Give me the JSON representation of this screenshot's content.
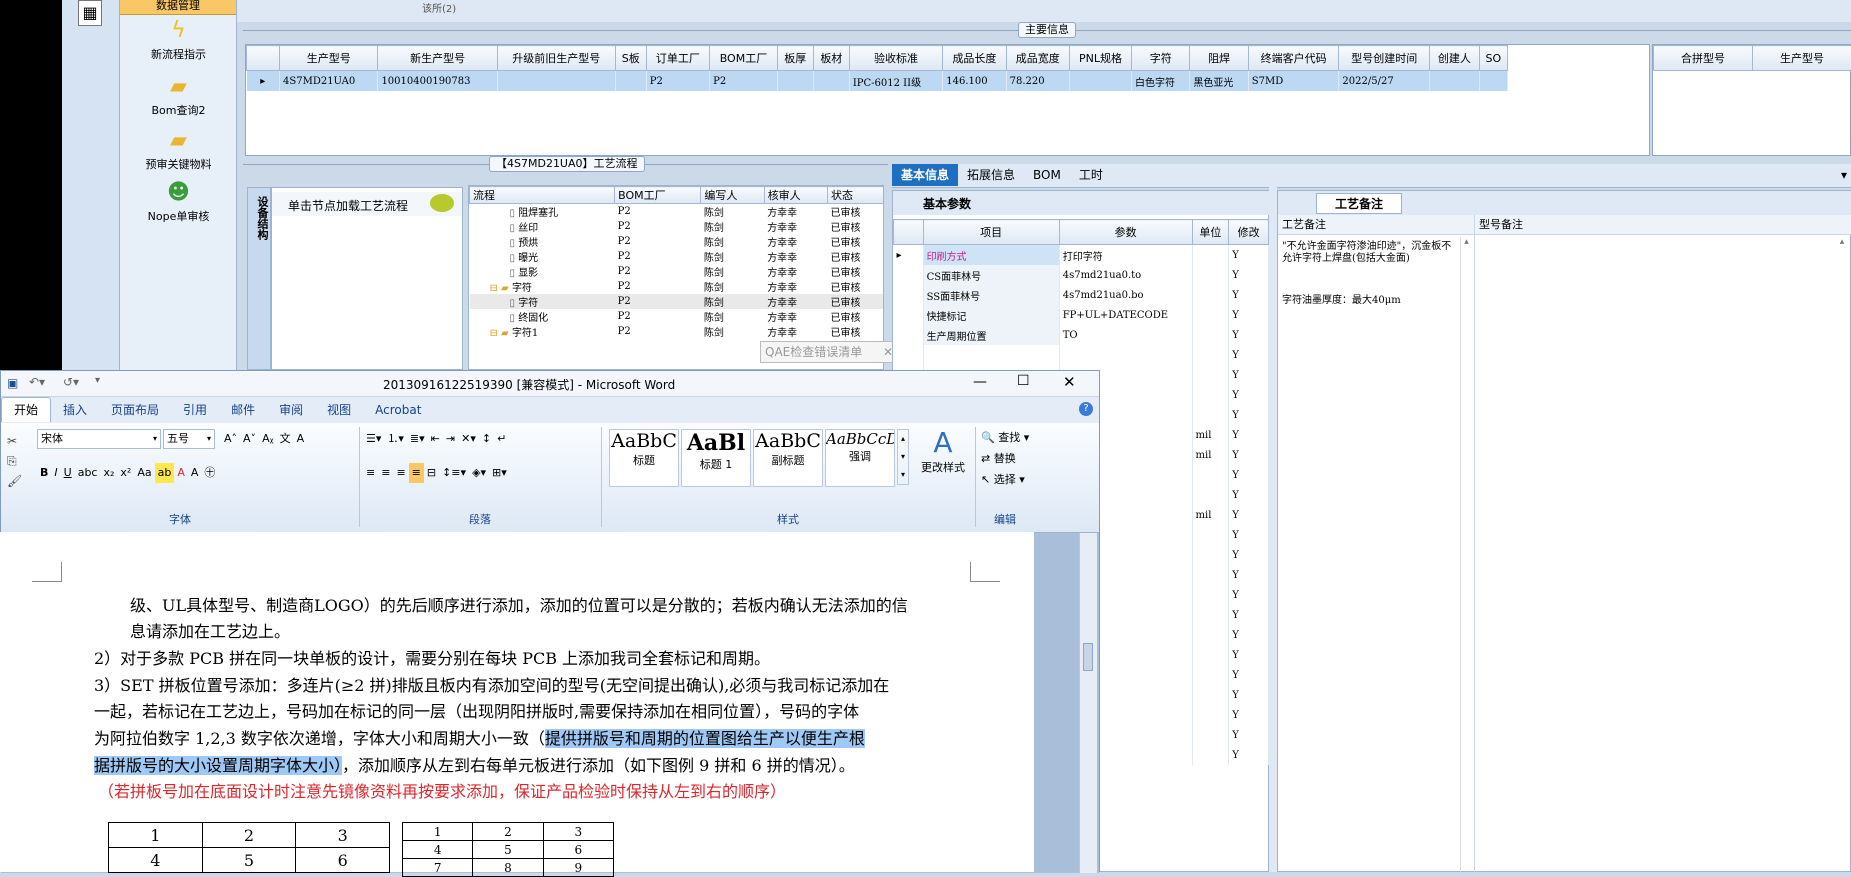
{
  "left_nav": {
    "top_tab": "数据管理"
  },
  "quick_items": [
    {
      "label": "新流程指示",
      "icon": "lightning-icon"
    },
    {
      "label": "Bom查询2",
      "icon": "folder-icon"
    },
    {
      "label": "预审关键物料",
      "icon": "folder-icon"
    },
    {
      "label": "Nope单审核",
      "icon": "user-icon"
    }
  ],
  "top_text": "该所(2)",
  "main_info": {
    "title": "主要信息",
    "columns": [
      "生产型号",
      "新生产型号",
      "升级前旧生产型号",
      "S板",
      "订单工厂",
      "BOM工厂",
      "板厚",
      "板材",
      "验收标准",
      "成品长度",
      "成品宽度",
      "PNL规格",
      "字符",
      "阻焊",
      "终端客户代码",
      "型号创建时间",
      "创建人",
      "SO"
    ],
    "row": [
      "4S7MD21UA0",
      "10010400190783",
      "",
      "",
      "P2",
      "P2",
      "",
      "",
      "IPC-6012 II级",
      "146.100",
      "78.220",
      "",
      "白色字符",
      "黑色亚光",
      "S7MD",
      "2022/5/27",
      "",
      ""
    ],
    "right_columns": [
      "合拼型号",
      "生产型号"
    ]
  },
  "process": {
    "title": "【4S7MD21UA0】工艺流程",
    "side_tab": "设备结构",
    "hint": "单击节点加载工艺流程",
    "columns": [
      "流程",
      "BOM工厂",
      "编写人",
      "核审人",
      "状态"
    ],
    "rows": [
      {
        "name": "阻焊塞孔",
        "bom": "P2",
        "writer": "陈剑",
        "reviewer": "方幸幸",
        "status": "已审核"
      },
      {
        "name": "丝印",
        "bom": "P2",
        "writer": "陈剑",
        "reviewer": "方幸幸",
        "status": "已审核"
      },
      {
        "name": "预烘",
        "bom": "P2",
        "writer": "陈剑",
        "reviewer": "方幸幸",
        "status": "已审核"
      },
      {
        "name": "曝光",
        "bom": "P2",
        "writer": "陈剑",
        "reviewer": "方幸幸",
        "status": "已审核"
      },
      {
        "name": "显影",
        "bom": "P2",
        "writer": "陈剑",
        "reviewer": "方幸幸",
        "status": "已审核"
      },
      {
        "name": "字符",
        "bom": "P2",
        "writer": "陈剑",
        "reviewer": "方幸幸",
        "status": "已审核"
      },
      {
        "name": "字符",
        "bom": "P2",
        "writer": "陈剑",
        "reviewer": "方幸幸",
        "status": "已审核"
      },
      {
        "name": "终固化",
        "bom": "P2",
        "writer": "陈剑",
        "reviewer": "方幸幸",
        "status": "已审核"
      },
      {
        "name": "字符1",
        "bom": "P2",
        "writer": "陈剑",
        "reviewer": "方幸幸",
        "status": "已审核"
      }
    ],
    "qae_popup": "QAE检查错误清单"
  },
  "right_tabs": [
    "基本信息",
    "拓展信息",
    "BOM",
    "工时"
  ],
  "basic_params": {
    "title": "基本参数",
    "columns": [
      "项目",
      "参数",
      "单位",
      "修改"
    ],
    "rows": [
      {
        "item": "印刷方式",
        "param": "打印字符",
        "unit": "",
        "mod": "Y"
      },
      {
        "item": "CS面菲林号",
        "param": "4s7md21ua0.to",
        "unit": "",
        "mod": "Y"
      },
      {
        "item": "SS面菲林号",
        "param": "4s7md21ua0.bo",
        "unit": "",
        "mod": "Y"
      },
      {
        "item": "快捷标记",
        "param": "FP+UL+DATECODE",
        "unit": "",
        "mod": "Y"
      },
      {
        "item": "生产周期位置",
        "param": "TO",
        "unit": "",
        "mod": "Y"
      }
    ],
    "extra_rows": [
      {
        "unit": "",
        "mod": "Y"
      },
      {
        "unit": "",
        "mod": "Y"
      },
      {
        "unit": "",
        "mod": "Y"
      },
      {
        "unit": "",
        "mod": "Y"
      },
      {
        "unit": "mil",
        "mod": "Y"
      },
      {
        "unit": "mil",
        "mod": "Y"
      },
      {
        "unit": "",
        "mod": "Y"
      },
      {
        "unit": "",
        "mod": "Y"
      },
      {
        "unit": "mil",
        "mod": "Y"
      },
      {
        "unit": "",
        "mod": "Y"
      },
      {
        "unit": "",
        "mod": "Y"
      },
      {
        "unit": "",
        "mod": "Y"
      },
      {
        "unit": "",
        "mod": "Y"
      },
      {
        "unit": "",
        "mod": "Y"
      },
      {
        "unit": "",
        "mod": "Y"
      },
      {
        "unit": "",
        "mod": "Y"
      },
      {
        "unit": "",
        "mod": "Y"
      },
      {
        "unit": "",
        "mod": "Y"
      },
      {
        "unit": "",
        "mod": "Y"
      },
      {
        "unit": "",
        "mod": "Y"
      },
      {
        "unit": "",
        "mod": "Y"
      }
    ]
  },
  "process_notes": {
    "tab": "工艺备注",
    "col1": "工艺备注",
    "col2": "型号备注",
    "note1": "\"不允许金面字符渗油印迹\"，沉金板不允许字符上焊盘(包括大金面)",
    "note2": "字符油墨厚度：最大40μm"
  },
  "word": {
    "title": "20130916122519390 [兼容模式] - Microsoft Word",
    "tabs": [
      "开始",
      "插入",
      "页面布局",
      "引用",
      "邮件",
      "审阅",
      "视图",
      "Acrobat"
    ],
    "font_name": "宋体",
    "font_size": "五号",
    "groups": [
      "字体",
      "段落",
      "样式",
      "编辑"
    ],
    "styles": [
      {
        "preview": "AaBbC",
        "label": "标题"
      },
      {
        "preview": "AaBl",
        "label": "标题 1"
      },
      {
        "preview": "AaBbC",
        "label": "副标题"
      },
      {
        "preview": "AaBbCcD",
        "label": "强调"
      }
    ],
    "change_styles": "更改样式",
    "edit_items": [
      "查找",
      "替换",
      "选择"
    ],
    "doc_lines": {
      "l1": "级、UL具体型号、制造商LOGO）的先后顺序进行添加，添加的位置可以是分散的；若板内确认无法添加的信",
      "l2": "息请添加在工艺边上。",
      "l3": "2）对于多款 PCB 拼在同一块单板的设计，需要分别在每块 PCB 上添加我司全套标记和周期。",
      "l4": "3）SET 拼板位置号添加：多连片(≥2 拼)排版且板内有添加空间的型号(无空间提出确认),必须与我司标记添加在",
      "l5": "一起，若标记在工艺边上，号码加在标记的同一层（出现阴阳拼版时,需要保持添加在相同位置），号码的字体",
      "l6a": "为阿拉伯数字  1,2,3  数字依次递增，字体大小和周期大小一致（",
      "l6b": "提供拼版号和周期的位置图给生产以便生产根",
      "l7a": "据拼版号的大小设置周期字体大小）",
      "l7b": "，添加顺序从左到右每单元板进行添加（如下图例 9 拼和 6 拼的情况）。",
      "l8": "（若拼板号加在底面设计时注意先镜像资料再按要求添加，保证产品检验时保持从左到右的顺序）"
    },
    "table6": [
      [
        "1",
        "2",
        "3"
      ],
      [
        "4",
        "5",
        "6"
      ]
    ],
    "table9": [
      [
        "1",
        "2",
        "3"
      ],
      [
        "4",
        "5",
        "6"
      ],
      [
        "7",
        "8",
        "9"
      ]
    ]
  }
}
